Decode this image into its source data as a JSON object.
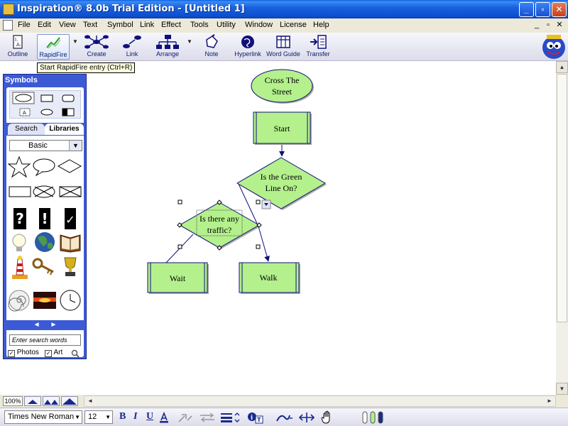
{
  "window": {
    "title": "Inspiration® 8.0b Trial Edition - [Untitled 1]",
    "min_label": "_",
    "max_label": "▫",
    "close_label": "✕"
  },
  "menu": {
    "items": [
      "File",
      "Edit",
      "View",
      "Text",
      "Symbol",
      "Link",
      "Effect",
      "Tools",
      "Utility",
      "Window",
      "License",
      "Help"
    ],
    "mdi": [
      "_",
      "▫",
      "✕"
    ]
  },
  "toolbar": {
    "buttons": [
      {
        "label": "Outline",
        "icon": "outline-icon"
      },
      {
        "label": "RapidFire",
        "icon": "rapidfire-icon"
      },
      {
        "label": "Create",
        "icon": "create-icon"
      },
      {
        "label": "Link",
        "icon": "link-icon"
      },
      {
        "label": "Arrange",
        "icon": "arrange-icon"
      },
      {
        "label": "Note",
        "icon": "note-icon"
      },
      {
        "label": "Hyperlink",
        "icon": "hyperlink-icon"
      },
      {
        "label": "Word Guide",
        "icon": "word-guide-icon"
      },
      {
        "label": "Transfer",
        "icon": "transfer-icon"
      }
    ],
    "tooltip": "Start RapidFire entry (Ctrl+R)"
  },
  "diagram": {
    "nodes": [
      {
        "id": "cross",
        "shape": "ellipse",
        "lines": [
          "Cross The",
          "Street"
        ]
      },
      {
        "id": "start",
        "shape": "rect",
        "lines": [
          "Start"
        ]
      },
      {
        "id": "green",
        "shape": "diamond",
        "lines": [
          "Is the Green",
          "Line On?"
        ]
      },
      {
        "id": "traffic",
        "shape": "diamond",
        "lines": [
          "Is there any",
          "traffic?"
        ]
      },
      {
        "id": "wait",
        "shape": "rect",
        "lines": [
          "Wait"
        ]
      },
      {
        "id": "walk",
        "shape": "rect",
        "lines": [
          "Walk"
        ]
      }
    ],
    "fill_color": "#b4f08c",
    "link_color": "#10107a"
  },
  "symbols_panel": {
    "title": "Symbols",
    "tabs": [
      "Search",
      "Libraries"
    ],
    "library": "Basic",
    "search_placeholder": "Enter search words",
    "photos_label": "Photos",
    "art_label": "Art",
    "nav_prev": "◄",
    "nav_next": "►",
    "items": [
      "star",
      "speech-bubble",
      "diamond",
      "rectangle",
      "crossed-ellipse",
      "crossed-rectangle",
      "question-mark",
      "exclamation-mark",
      "check-mark",
      "light-bulb",
      "earth",
      "book",
      "lighthouse",
      "key",
      "trophy",
      "spiral",
      "sunset",
      "clock"
    ]
  },
  "zoom": {
    "value": "100%"
  },
  "format": {
    "font": "Times New Roman",
    "size": "12",
    "bold": "B",
    "italic": "I",
    "underline": "U"
  }
}
